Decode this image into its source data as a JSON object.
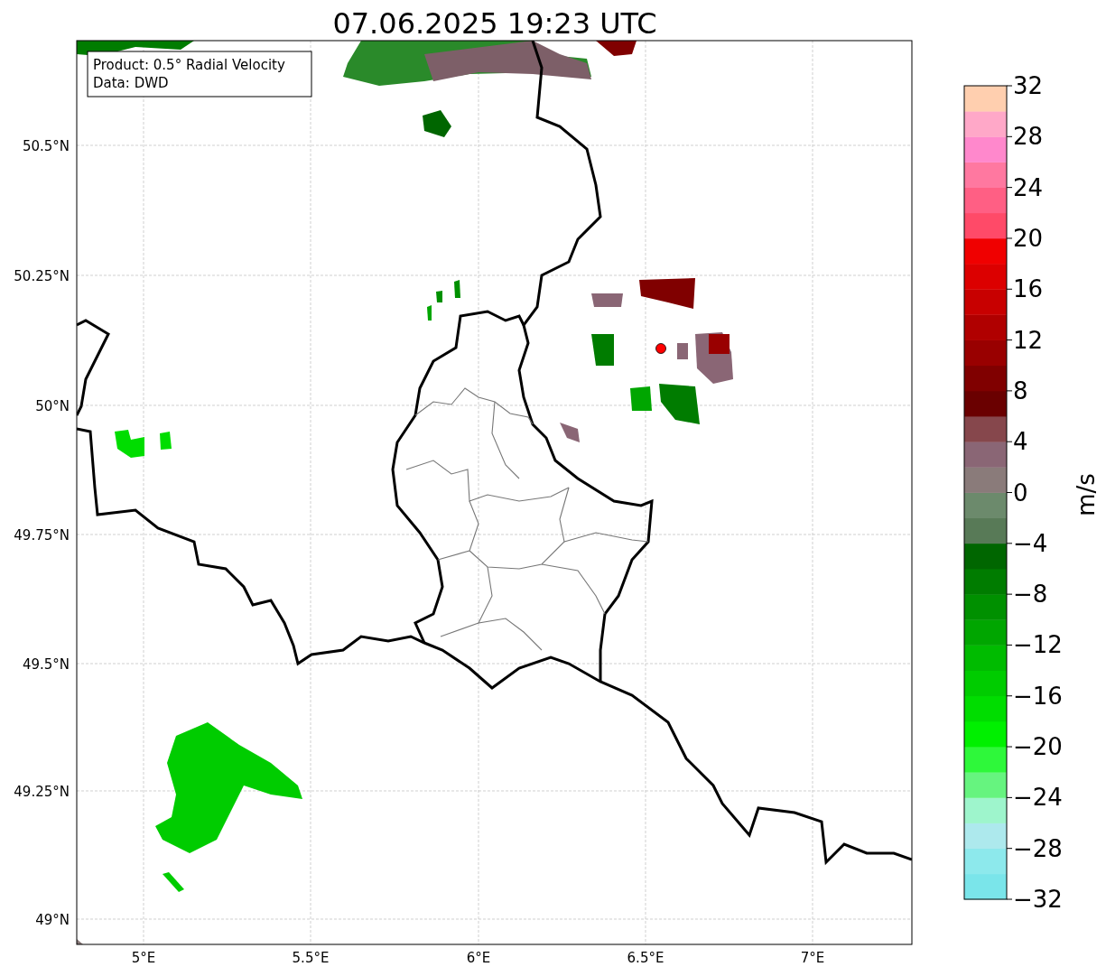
{
  "title": "07.06.2025 19:23 UTC",
  "info_box": {
    "lines": [
      "Product: 0.5° Radial Velocity",
      "Data: DWD"
    ]
  },
  "map": {
    "lat_labels": [
      "50.5°N",
      "50.25°N",
      "50°N",
      "49.75°N",
      "49.5°N",
      "49.25°N",
      "49°N"
    ],
    "lon_labels": [
      "5°E",
      "5.5°E",
      "6°E",
      "6.5°E",
      "7°E"
    ]
  },
  "colorbar": {
    "label": "m/s",
    "ticks": [
      "32",
      "28",
      "24",
      "20",
      "16",
      "12",
      "8",
      "4",
      "0",
      "−4",
      "−8",
      "−12",
      "−16",
      "−20",
      "−24",
      "−28",
      "−32"
    ],
    "segments": [
      {
        "color": "#7ae5ea"
      },
      {
        "color": "#8de9ec"
      },
      {
        "color": "#ade9ed"
      },
      {
        "color": "#9ef5cc"
      },
      {
        "color": "#66f47f"
      },
      {
        "color": "#2ef83a"
      },
      {
        "color": "#00f000"
      },
      {
        "color": "#00dd00"
      },
      {
        "color": "#00cc00"
      },
      {
        "color": "#00bb00"
      },
      {
        "color": "#00a600"
      },
      {
        "color": "#009000"
      },
      {
        "color": "#007c00"
      },
      {
        "color": "#006600"
      },
      {
        "color": "#587a57"
      },
      {
        "color": "#6c8a6c"
      },
      {
        "color": "#8a7b7a"
      },
      {
        "color": "#8a6675"
      },
      {
        "color": "#86474c"
      },
      {
        "color": "#6a0000"
      },
      {
        "color": "#800000"
      },
      {
        "color": "#990000"
      },
      {
        "color": "#b00000"
      },
      {
        "color": "#c80000"
      },
      {
        "color": "#dc0000"
      },
      {
        "color": "#f00000"
      },
      {
        "color": "#ff4a68"
      },
      {
        "color": "#ff5f84"
      },
      {
        "color": "#ff78a0"
      },
      {
        "color": "#ff88cc"
      },
      {
        "color": "#ffa8c8"
      },
      {
        "color": "#ffcfaf"
      }
    ]
  }
}
